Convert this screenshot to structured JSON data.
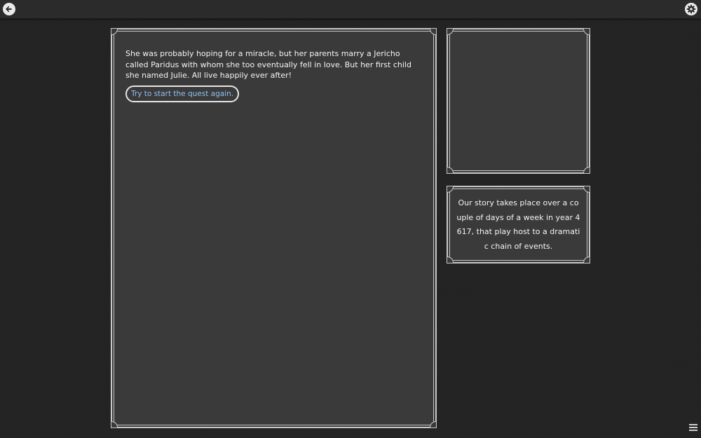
{
  "topbar": {
    "back_icon": "back-arrow-icon",
    "settings_icon": "gear-icon"
  },
  "story": {
    "text": "She was probably hoping for a miracle, but her parents marry a Jericho called Paridus with whom she too eventually fell in love. But her first child she named Julie. All live happily ever after!",
    "restart_label": "Try to start the quest again."
  },
  "info": {
    "text": "Our story takes place over a couple of days of a week in year 4617, that play host to a dramatic chain of events."
  },
  "menu": {
    "icon": "hamburger-menu-icon"
  },
  "colors": {
    "background": "#232323",
    "panel": "#3a3a3a",
    "panel_border": "#c8c8c8",
    "link": "#8ec1ee"
  }
}
